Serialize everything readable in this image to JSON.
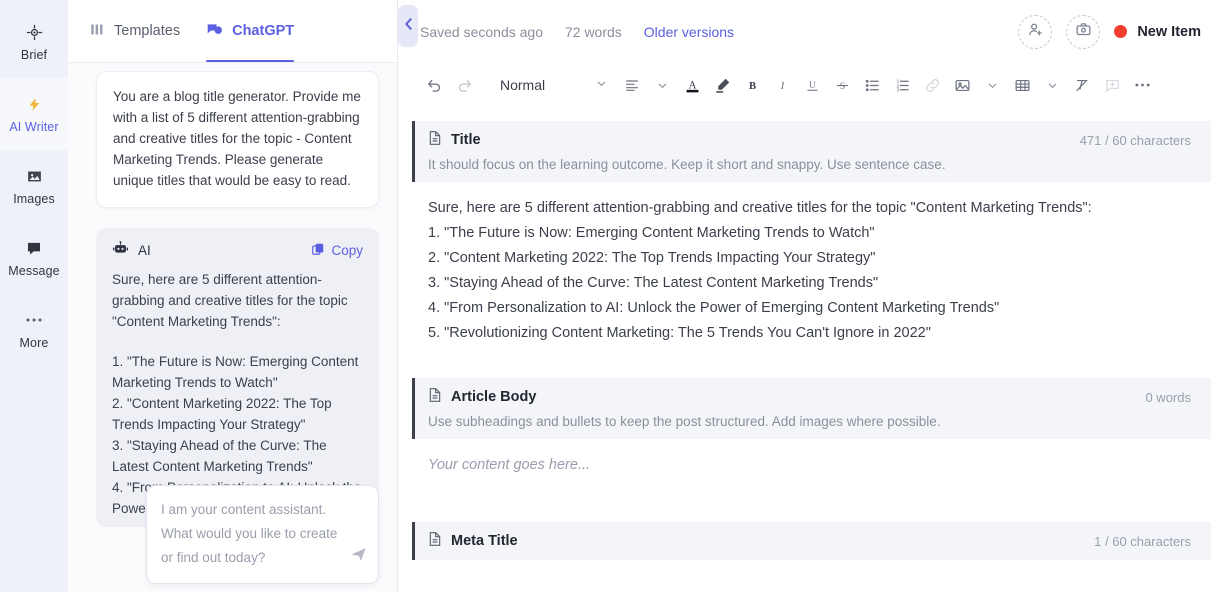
{
  "colors": {
    "accent": "#5b5fe0",
    "rail_bg": "#eef0fa",
    "status_dot": "#f03e2f",
    "section_bar": "#3c4049"
  },
  "rail": {
    "items": [
      {
        "label": "Brief",
        "icon": "target-icon",
        "active": false
      },
      {
        "label": "AI Writer",
        "icon": "lightning-icon",
        "active": true
      },
      {
        "label": "Images",
        "icon": "image-icon",
        "active": false
      },
      {
        "label": "Message",
        "icon": "chat-icon",
        "active": false
      },
      {
        "label": "More",
        "icon": "ellipsis-icon",
        "active": false
      }
    ]
  },
  "chat": {
    "tabs": [
      {
        "label": "Templates",
        "icon": "templates-icon",
        "active": false
      },
      {
        "label": "ChatGPT",
        "icon": "chat-bubbles-icon",
        "active": true
      }
    ],
    "user_message": "You are a blog title generator. Provide me with a list of 5 different attention-grabbing and creative titles for the topic - Content Marketing Trends. Please generate unique titles that would be easy to read.",
    "ai": {
      "name": "AI",
      "icon": "robot-icon",
      "copy_label": "Copy",
      "copy_icon": "copy-icon",
      "intro": "Sure, here are 5 different attention-grabbing and creative titles for the topic \"Content Marketing Trends\":",
      "list": [
        "1. \"The Future is Now: Emerging Content Marketing Trends to Watch\"",
        "2. \"Content Marketing 2022: The Top Trends Impacting Your Strategy\"",
        "3. \"Staying Ahead of the Curve: The Latest Content Marketing Trends\"",
        "4. \"From Personalization to AI: Unlock the Power of Emerging Content"
      ]
    },
    "input_placeholder": "I am your content assistant. What would you like to create or find out today?",
    "input_value": "",
    "send_icon": "send-icon",
    "collapse_icon": "chevron-left-icon"
  },
  "editor": {
    "saved_status": "Saved seconds ago",
    "word_count": "72 words",
    "older_versions": "Older versions",
    "share_icon": "add-person-icon",
    "brief_icon": "add-brief-icon",
    "new_item_label": "New Item",
    "toolbar": {
      "undo": "undo-icon",
      "redo": "redo-icon",
      "style_value": "Normal",
      "style_chevron": "chevron-down-icon",
      "align": "align-icon",
      "align_chevron": "chevron-down-icon",
      "text_color": "A",
      "highlight": "highlighter-icon",
      "bold": "B",
      "italic": "I",
      "underline": "U",
      "strike": "S",
      "bullet_list": "bullet-list-icon",
      "numbered_list": "numbered-list-icon",
      "link": "link-icon",
      "image": "image-icon",
      "image_chevron": "chevron-down-icon",
      "table": "table-icon",
      "table_chevron": "chevron-down-icon",
      "clear_format": "clear-format-icon",
      "comment": "comment-icon",
      "more": "ellipsis-icon"
    },
    "sections": [
      {
        "title": "Title",
        "icon": "document-icon",
        "count": "471 / 60 characters",
        "hint": "It should focus on the learning outcome. Keep it short and snappy. Use sentence case.",
        "lines": [
          "Sure, here are 5 different attention-grabbing and creative titles for the topic \"Content Marketing Trends\":",
          "1. \"The Future is Now: Emerging Content Marketing Trends to Watch\"",
          "2. \"Content Marketing 2022: The Top Trends Impacting Your Strategy\"",
          "3. \"Staying Ahead of the Curve: The Latest Content Marketing Trends\"",
          "4. \"From Personalization to AI: Unlock the Power of Emerging Content Marketing Trends\"",
          "5. \"Revolutionizing Content Marketing: The 5 Trends You Can't Ignore in 2022\""
        ],
        "placeholder": ""
      },
      {
        "title": "Article Body",
        "icon": "document-icon",
        "count": "0 words",
        "hint": "Use subheadings and bullets to keep the post structured. Add images where possible.",
        "lines": [],
        "placeholder": "Your content goes here..."
      },
      {
        "title": "Meta Title",
        "icon": "document-icon",
        "count": "1 / 60 characters",
        "hint": "",
        "lines": [],
        "placeholder": ""
      }
    ]
  }
}
